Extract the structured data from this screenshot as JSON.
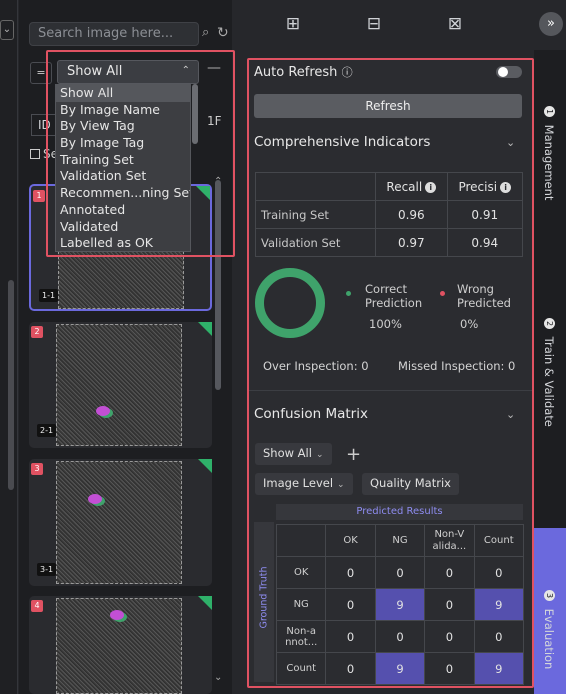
{
  "left_strip": {
    "dropdown_icon": "chevron-down-icon"
  },
  "gallery": {
    "search_placeholder": "Search image here...",
    "filter_icon": "=",
    "select_value": "Show All",
    "dropdown_options": [
      "Show All",
      "By Image Name",
      "By View Tag",
      "By Image Tag",
      "Training Set",
      "Validation Set",
      "Recommen...ning Set",
      "Annotated",
      "Validated",
      "Labelled as OK"
    ],
    "id_col": "ID",
    "count": "1F",
    "select_all": "Sel",
    "cards": [
      {
        "num": "1",
        "label": "1-1"
      },
      {
        "num": "2",
        "label": "2-1"
      },
      {
        "num": "3",
        "label": "3-1"
      },
      {
        "num": "4",
        "label": ""
      }
    ]
  },
  "panel": {
    "auto_refresh": "Auto Refresh",
    "refresh_button": "Refresh",
    "comprehensive_title": "Comprehensive Indicators",
    "metrics_headers": [
      "Recall",
      "Precisi"
    ],
    "metrics_rows": [
      {
        "label": "Training Set",
        "recall": "0.96",
        "precision": "0.91"
      },
      {
        "label": "Validation Set",
        "recall": "0.97",
        "precision": "0.94"
      }
    ],
    "correct_label": "Correct Prediction",
    "correct_value": "100%",
    "wrong_label": "Wrong Predicted",
    "wrong_value": "0%",
    "correct_color": "#3fa36b",
    "wrong_color": "#e05262",
    "over_inspection": "Over Inspection: 0",
    "missed_inspection": "Missed Inspection: 0",
    "confusion_title": "Confusion Matrix",
    "show_all": "Show All",
    "image_level": "Image Level",
    "quality_matrix": "Quality Matrix",
    "predicted_results": "Predicted Results",
    "ground_truth": "Ground Truth",
    "cm_cols": [
      "OK",
      "NG",
      "Non-V alida...",
      "Count"
    ],
    "cm_rows": [
      {
        "label": "OK",
        "values": [
          "0",
          "0",
          "0",
          "0"
        ]
      },
      {
        "label": "NG",
        "values": [
          "0",
          "9",
          "0",
          "9"
        ]
      },
      {
        "label": "Non-a nnot...",
        "values": [
          "0",
          "0",
          "0",
          "0"
        ]
      },
      {
        "label": "Count",
        "values": [
          "0",
          "9",
          "0",
          "9"
        ]
      }
    ]
  },
  "side_tabs": [
    {
      "num": "1",
      "label": "Management"
    },
    {
      "num": "2",
      "label": "Train & Validate"
    },
    {
      "num": "3",
      "label": "Evaluation"
    }
  ]
}
